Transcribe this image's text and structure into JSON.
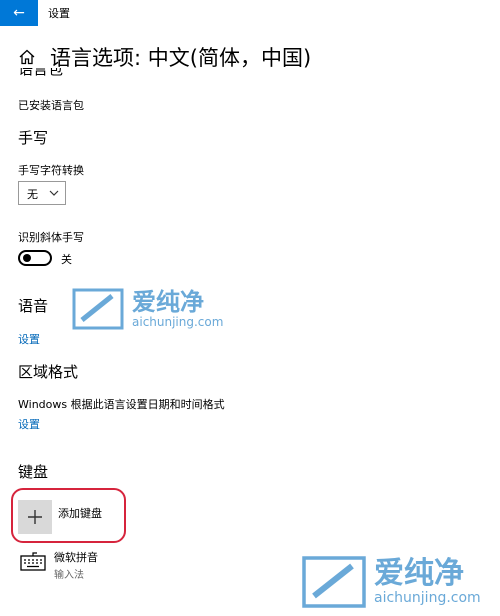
{
  "window": {
    "title": "设置",
    "back_glyph": "←"
  },
  "page": {
    "title": "语言选项: 中文(简体，中国)"
  },
  "sections": {
    "language_pack": {
      "heading_partial": "语言包",
      "status": "已安装语言包"
    },
    "handwriting": {
      "heading": "手写",
      "convert_label": "手写字符转换",
      "convert_value": "无",
      "recognize_label": "识别斜体手写",
      "toggle_state": "关"
    },
    "speech": {
      "heading": "语音",
      "settings_link": "设置"
    },
    "region": {
      "heading": "区域格式",
      "description": "Windows 根据此语言设置日期和时间格式",
      "settings_link": "设置"
    },
    "keyboard": {
      "heading": "键盘",
      "add_label": "添加键盘",
      "items": [
        {
          "name": "微软拼音",
          "subtitle": "输入法"
        }
      ]
    }
  },
  "watermarks": [
    {
      "cn": "爱纯净",
      "en": "aichunjing.com"
    },
    {
      "cn": "爱纯净",
      "en": "aichunjing.com"
    }
  ],
  "colors": {
    "accent": "#0078d7",
    "link": "#0067b8",
    "highlight": "#d6243c",
    "watermark": "#6aa9d8"
  }
}
